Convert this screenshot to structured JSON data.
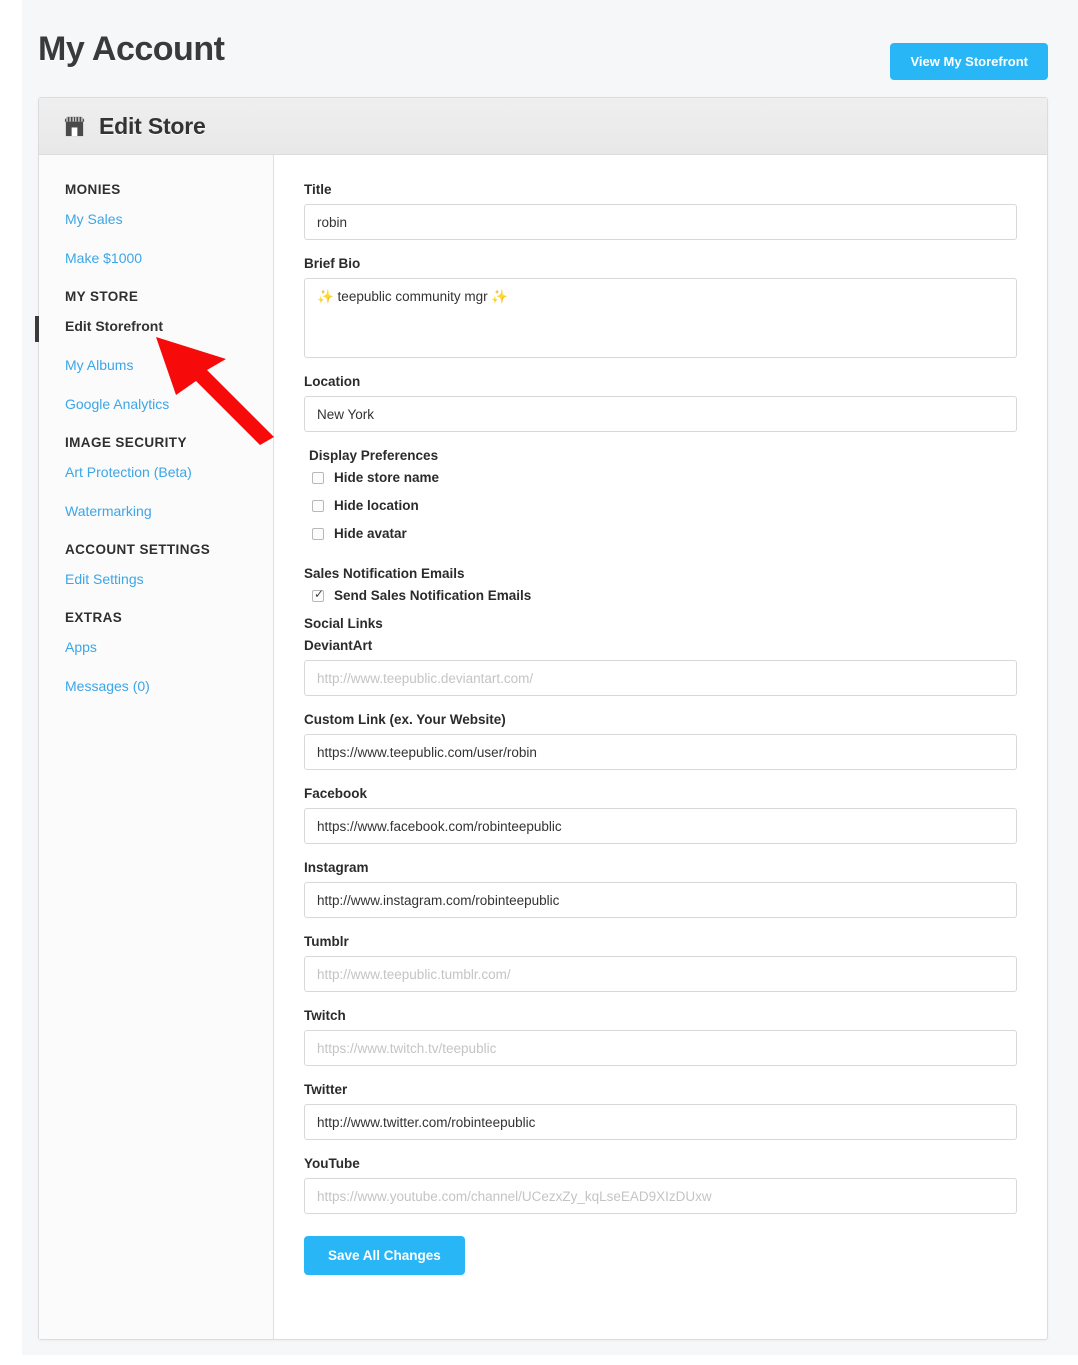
{
  "header": {
    "title": "My Account",
    "storefront_button": "View My Storefront",
    "accent_color": "#29b6f6"
  },
  "panel": {
    "icon": "storefront-icon",
    "title": "Edit Store"
  },
  "sidebar": {
    "active_item": "Edit Storefront",
    "groups": [
      {
        "heading": "MONIES",
        "items": [
          {
            "label": "My Sales",
            "active": false
          },
          {
            "label": "Make $1000",
            "active": false
          }
        ]
      },
      {
        "heading": "MY STORE",
        "items": [
          {
            "label": "Edit Storefront",
            "active": true
          },
          {
            "label": "My Albums",
            "active": false
          },
          {
            "label": "Google Analytics",
            "active": false
          }
        ]
      },
      {
        "heading": "IMAGE SECURITY",
        "items": [
          {
            "label": "Art Protection (Beta)",
            "active": false
          },
          {
            "label": "Watermarking",
            "active": false
          }
        ]
      },
      {
        "heading": "ACCOUNT SETTINGS",
        "items": [
          {
            "label": "Edit Settings",
            "active": false
          }
        ]
      },
      {
        "heading": "EXTRAS",
        "items": [
          {
            "label": "Apps",
            "active": false
          },
          {
            "label": "Messages (0)",
            "active": false
          }
        ]
      }
    ]
  },
  "form": {
    "title_label": "Title",
    "title_value": "robin",
    "title_placeholder": "",
    "bio_label": "Brief Bio",
    "bio_value": "✨ teepublic community mgr ✨",
    "bio_placeholder": "",
    "location_label": "Location",
    "location_value": "New York",
    "location_placeholder": "",
    "display_preferences_label": "Display Preferences",
    "display_preferences": [
      {
        "label": "Hide store name",
        "checked": false
      },
      {
        "label": "Hide location",
        "checked": false
      },
      {
        "label": "Hide avatar",
        "checked": false
      }
    ],
    "sales_notification_label": "Sales Notification Emails",
    "sales_notification": {
      "label": "Send Sales Notification Emails",
      "checked": true
    },
    "social_links_label": "Social Links",
    "social": [
      {
        "label": "DeviantArt",
        "value": "",
        "placeholder": "http://www.teepublic.deviantart.com/"
      },
      {
        "label": "Custom Link (ex. Your Website)",
        "value": "https://www.teepublic.com/user/robin",
        "placeholder": ""
      },
      {
        "label": "Facebook",
        "value": "https://www.facebook.com/robinteepublic",
        "placeholder": ""
      },
      {
        "label": "Instagram",
        "value": "http://www.instagram.com/robinteepublic",
        "placeholder": ""
      },
      {
        "label": "Tumblr",
        "value": "",
        "placeholder": "http://www.teepublic.tumblr.com/"
      },
      {
        "label": "Twitch",
        "value": "",
        "placeholder": "https://www.twitch.tv/teepublic"
      },
      {
        "label": "Twitter",
        "value": "http://www.twitter.com/robinteepublic",
        "placeholder": ""
      },
      {
        "label": "YouTube",
        "value": "",
        "placeholder": "https://www.youtube.com/channel/UCezxZy_kqLseEAD9XIzDUxw"
      }
    ],
    "save_button": "Save All Changes"
  },
  "annotation": {
    "arrow_color": "#f60a0a",
    "points_to": "Edit Storefront"
  }
}
